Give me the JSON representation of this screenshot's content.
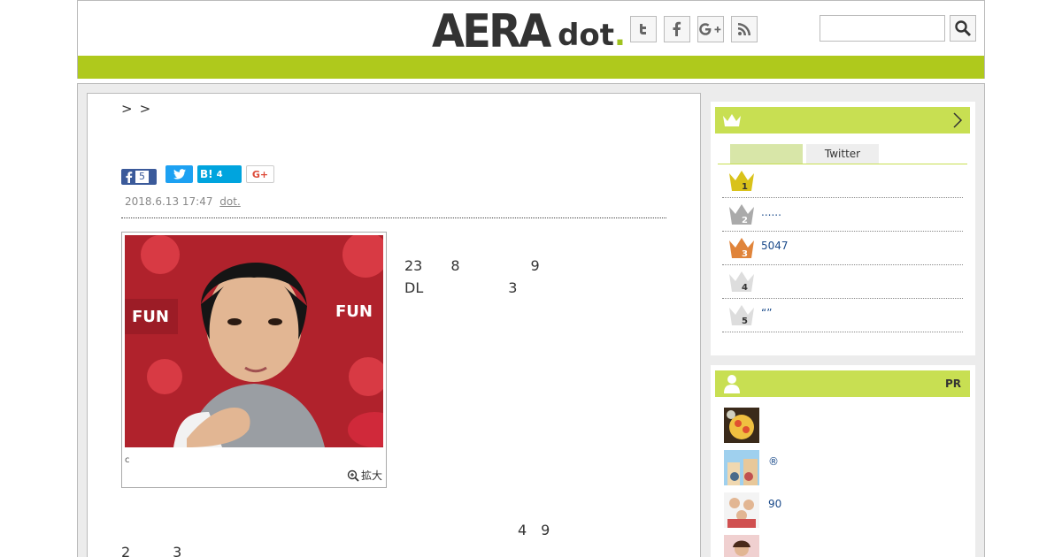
{
  "header": {
    "logo_main": "AERA",
    "logo_sub": "dot",
    "logo_dot": ".",
    "social": [
      {
        "icon": "twitter-icon",
        "glyph": "t"
      },
      {
        "icon": "facebook-icon",
        "glyph": "f"
      },
      {
        "icon": "google-plus-icon",
        "glyph": "G+"
      },
      {
        "icon": "rss-icon",
        "glyph": ""
      }
    ],
    "search": {
      "value": "",
      "icon": "search-icon"
    },
    "accent": "#afc91c"
  },
  "article": {
    "breadcrumb_separators": [
      ">",
      ">"
    ],
    "share": {
      "facebook_count": "5",
      "hatena_label": "B!",
      "hatena_count": "4",
      "gplus_label": "G+"
    },
    "date": "2018.6.13 17:47",
    "source": "dot.",
    "photo_caption": "c",
    "zoom_label": "拡大",
    "paragraph1": "　　　　　　　　　　　　　　　　　　　　　　　　　　　　　　23　　8　　　　　9　　　　　　　　　　　　　　　　　　　DL　　　　　　3　　　　　　　　　　　　　　　　　　　　　　　　　　　",
    "subheading": "　　　　　　　　　　　　　　　",
    "paragraph2": "　　　　　　　　　　　　　　　　　　　　　　　　　　　　　　　　　　　　　　　　　　　　　　　　　　　　　　　　　　　　　　　　　　　",
    "paragraph3": "　　　　　　　　　　　　　　　　　　　　　　　　　　　　4　9　　　　　　　　　　　　　　　　　　　　　　　2　　　3　　　　　　　　　　　　　　　　　　　　　　　　　　　　　　　　　　　　　　　　"
  },
  "sidebar": {
    "ranking": {
      "tabs": [
        "",
        "Twitter"
      ],
      "items": [
        {
          "rank": "1",
          "text": "",
          "color": "#d9c21a"
        },
        {
          "rank": "2",
          "text": "......",
          "color": "#aaaaaa"
        },
        {
          "rank": "3",
          "text": "5047",
          "color": "#e0843a"
        },
        {
          "rank": "4",
          "text": "",
          "color": "#cccccc"
        },
        {
          "rank": "5",
          "text": "“”",
          "color": "#cccccc"
        }
      ]
    },
    "pr": {
      "label": "PR",
      "items": [
        {
          "text": ""
        },
        {
          "text": "®"
        },
        {
          "text": "90"
        },
        {
          "text": ""
        }
      ]
    }
  }
}
